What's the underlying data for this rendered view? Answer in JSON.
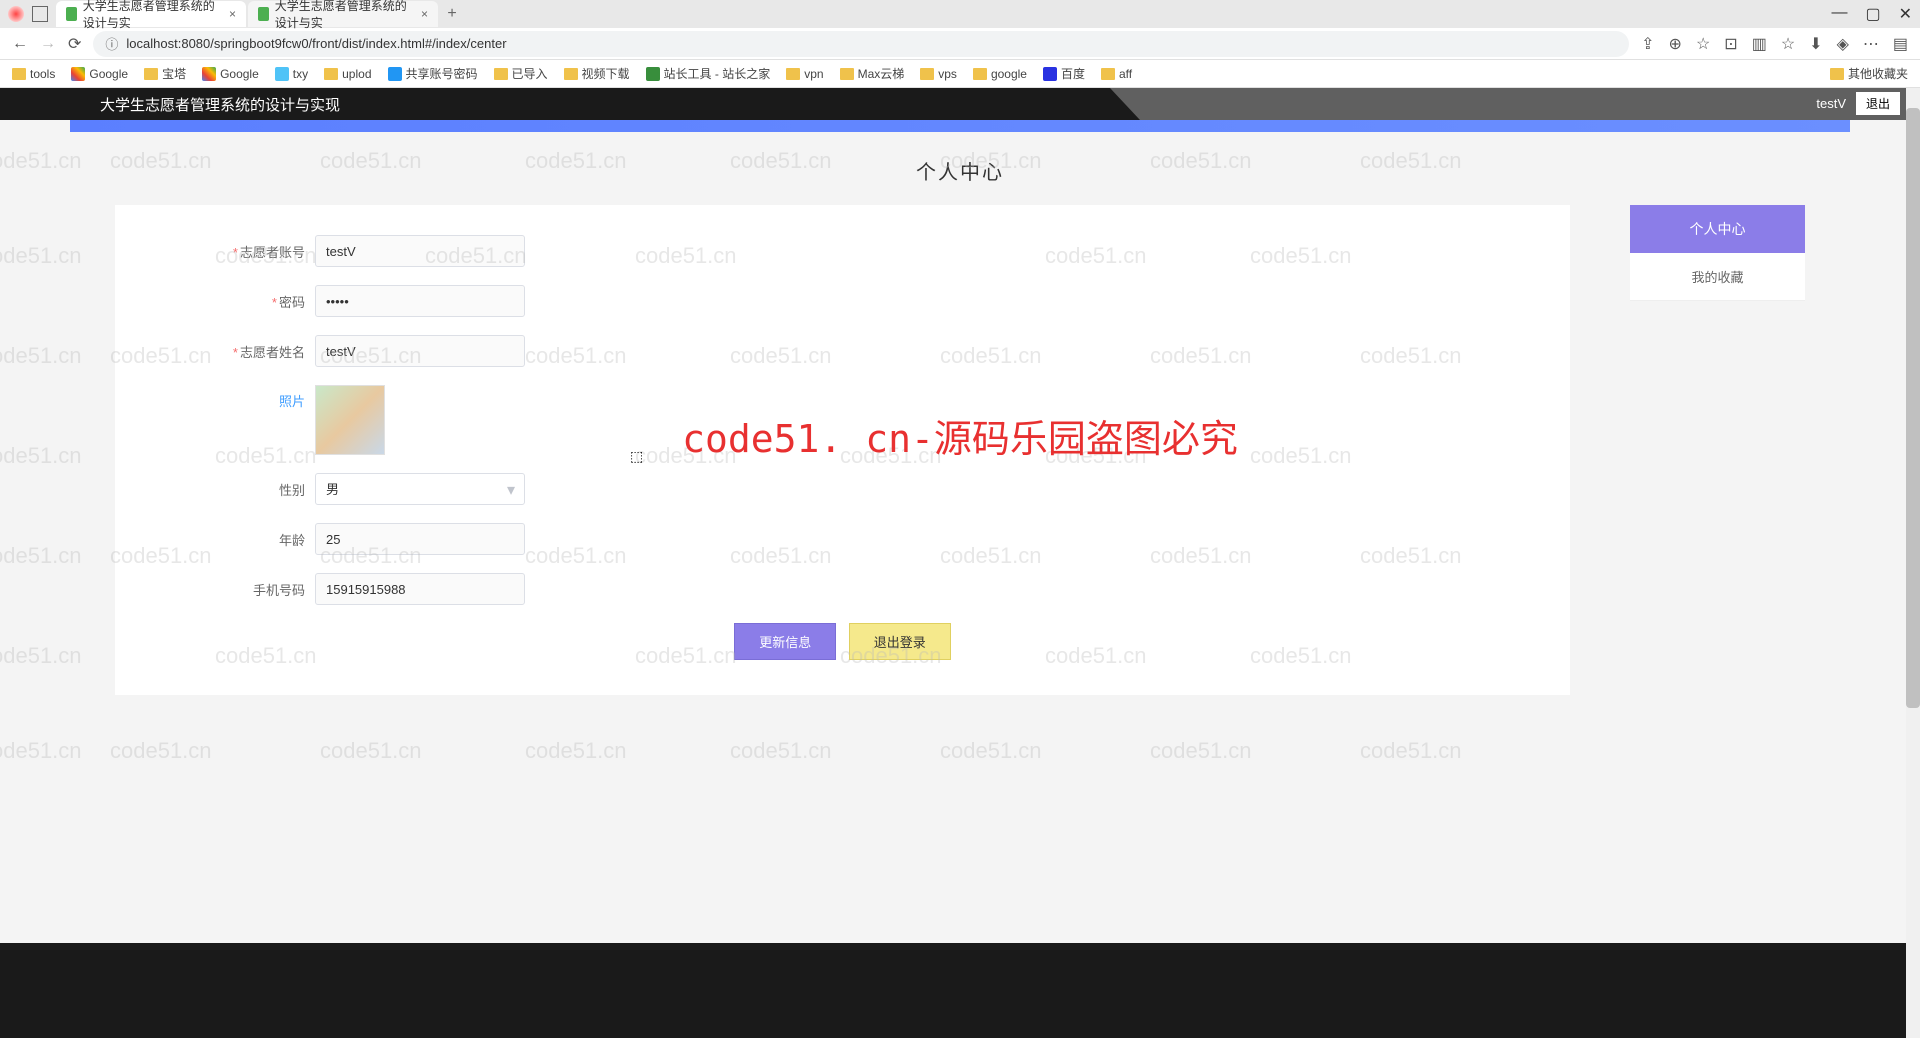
{
  "browser": {
    "tabs": [
      {
        "title": "大学生志愿者管理系统的设计与实",
        "active": true
      },
      {
        "title": "大学生志愿者管理系统的设计与实",
        "active": false
      }
    ],
    "url": "localhost:8080/springboot9fcw0/front/dist/index.html#/index/center",
    "bookmarks": [
      {
        "label": "tools",
        "type": "folder"
      },
      {
        "label": "Google",
        "type": "link"
      },
      {
        "label": "宝塔",
        "type": "folder"
      },
      {
        "label": "Google",
        "type": "link"
      },
      {
        "label": "txy",
        "type": "link"
      },
      {
        "label": "uplod",
        "type": "link"
      },
      {
        "label": "共享账号密码",
        "type": "link"
      },
      {
        "label": "已导入",
        "type": "folder"
      },
      {
        "label": "视频下载",
        "type": "folder"
      },
      {
        "label": "站长工具 - 站长之家",
        "type": "link"
      },
      {
        "label": "vpn",
        "type": "folder"
      },
      {
        "label": "Max云梯",
        "type": "link"
      },
      {
        "label": "vps",
        "type": "folder"
      },
      {
        "label": "google",
        "type": "folder"
      },
      {
        "label": "百度",
        "type": "link"
      },
      {
        "label": "aff",
        "type": "folder"
      }
    ],
    "other_bookmarks": "其他收藏夹"
  },
  "app": {
    "title": "大学生志愿者管理系统的设计与实现",
    "user": "testV",
    "logout": "退出",
    "page_heading": "个人中心",
    "form": {
      "account_label": "志愿者账号",
      "account_value": "testV",
      "password_label": "密码",
      "password_value": "•••••",
      "name_label": "志愿者姓名",
      "name_value": "testV",
      "photo_label": "照片",
      "gender_label": "性别",
      "gender_value": "男",
      "age_label": "年龄",
      "age_value": "25",
      "phone_label": "手机号码",
      "phone_value": "15915915988"
    },
    "buttons": {
      "update": "更新信息",
      "logout": "退出登录"
    },
    "side": {
      "center": "个人中心",
      "favorites": "我的收藏"
    }
  },
  "watermark": {
    "main": "code51. cn-源码乐园盗图必究",
    "repeat": "code51.cn"
  }
}
